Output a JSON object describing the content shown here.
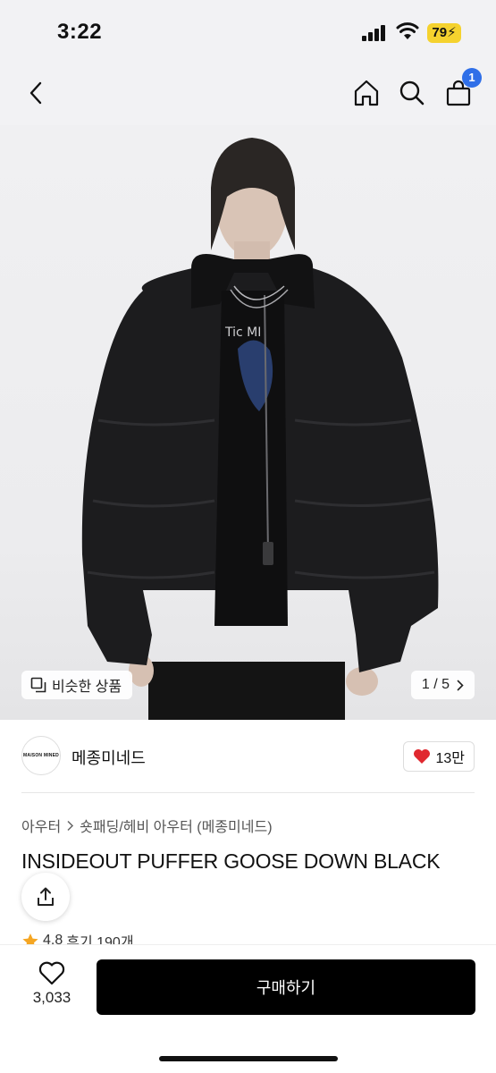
{
  "status_bar": {
    "time": "3:22",
    "battery": "79"
  },
  "nav": {
    "cart_count": "1"
  },
  "hero": {
    "similar_label": "비슷한 상품",
    "page_indicator": "1 / 5"
  },
  "brand": {
    "logo_text": "MAISON MINED",
    "name": "메종미네드",
    "likes": "13만"
  },
  "breadcrumb": {
    "parent": "아우터",
    "current": "숏패딩/헤비 아우터 (메종미네드)"
  },
  "product": {
    "title": "INSIDEOUT PUFFER GOOSE DOWN BLACK",
    "rating": "4.8",
    "reviews": "후기 190개"
  },
  "bottom": {
    "wish_count": "3,033",
    "buy_label": "구매하기"
  },
  "colors": {
    "accent_badge": "#2f6fe8",
    "heart": "#e0282f",
    "star": "#f5a623",
    "buy_button": "#000000"
  }
}
